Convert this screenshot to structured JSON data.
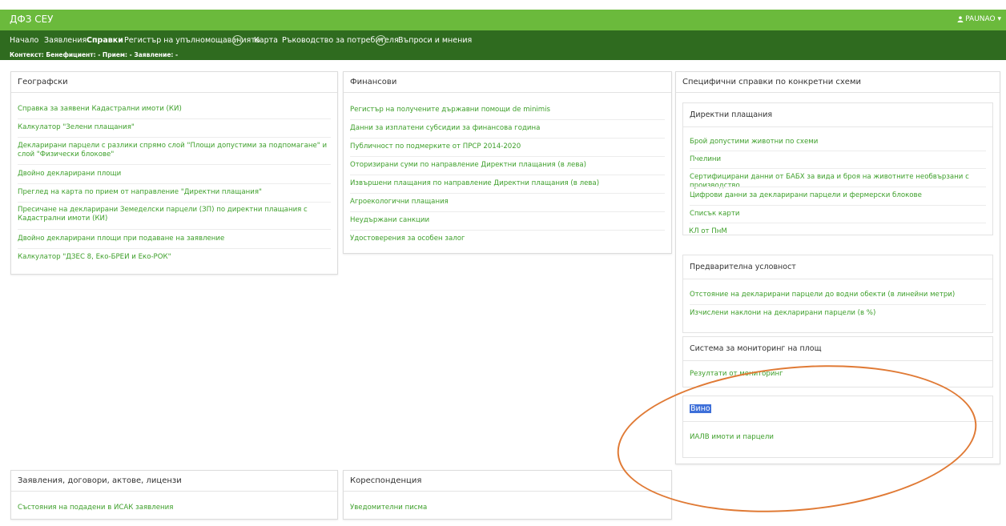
{
  "app": {
    "title": "ДФЗ СЕУ",
    "user": "PAUNAO"
  },
  "nav": {
    "items": [
      "Начало",
      "Заявления",
      "Справки",
      "Регистър на упълномощаванията",
      "Карта",
      "Ръководство за потребителя",
      "Въпроси и мнения"
    ],
    "active": "Справки"
  },
  "context": "Контекст: Бенефициент: - Прием: - Заявление: -",
  "panels": {
    "geo": {
      "title": "Географски",
      "links": [
        "Справка за заявени Кадастрални имоти (КИ)",
        "Калкулатор \"Зелени плащания\"",
        "Декларирани парцели с разлики спрямо слой \"Площи допустими за подпомагане\" и слой \"Физически блокове\"",
        "Двойно декларирани площи",
        "Преглед на карта по прием от направление \"Директни плащания\"",
        "Пресичане на декларирани Земеделски парцели (ЗП) по директни плащания с Кадастрални имоти (КИ)",
        "Двойно декларирани площи при подаване на заявление",
        "Калкулатор \"ДЗЕС 8, Еко-БРЕИ и Еко-РОК\""
      ]
    },
    "fin": {
      "title": "Финансови",
      "links": [
        "Регистър на получените държавни помощи de minimis",
        "Данни за изплатени субсидии за финансова година",
        "Публичност по подмерките от ПРСР 2014-2020",
        "Оторизирани суми по направление Директни плащания (в лева)",
        "Извършени плащания по направление Директни плащания (в лева)",
        "Агроекологични плащания",
        "Неудържани санкции",
        "Удостоверения за особен залог"
      ]
    },
    "spec": {
      "title": "Специфични справки по конкретни схеми",
      "direct": {
        "title": "Директни плащания",
        "links": [
          "Брой допустими животни по схеми",
          "Пчелини",
          "Сертифицирани данни от БАБХ за вида и броя на животните необвързани с производство",
          "Цифрови данни за декларирани парцели и фермерски блокове",
          "Списък карти",
          "КЛ от ПнМ"
        ]
      },
      "prelim": {
        "title": "Предварителна условност",
        "links": [
          "Отстояние на декларирани парцели до водни обекти (в линейни метри)",
          "Изчислени наклони на декларирани парцели (в %)"
        ]
      },
      "monitor": {
        "title": "Система за мониторинг на площ",
        "links": [
          "Резултати от мониторинг"
        ]
      },
      "wine": {
        "title": "Вино",
        "links": [
          "ИАЛВ имоти и парцели"
        ]
      }
    },
    "apps": {
      "title": "Заявления, договори, актове, лицензи",
      "links": [
        "Състояния на подадени в ИСАК заявления"
      ]
    },
    "corr": {
      "title": "Кореспонденция",
      "links": [
        "Уведомителни писма"
      ]
    }
  },
  "colors": {
    "appbar": "#6bba3c",
    "navbar": "#2f6b1f",
    "link": "#3d9f2a",
    "annotation": "#e07a35",
    "highlight": "#3d6fd9"
  }
}
